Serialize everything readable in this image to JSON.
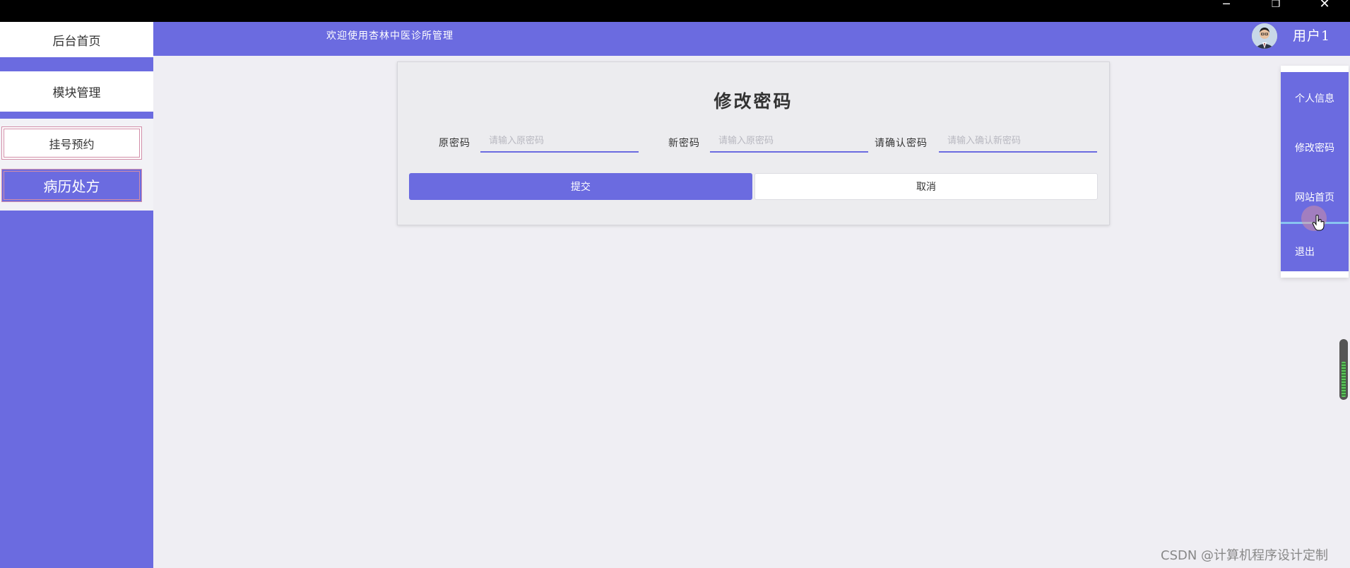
{
  "window": {
    "minimize_glyph": "─",
    "restore_glyph": "❐",
    "close_glyph": "✕"
  },
  "sidebar": {
    "home_label": "后台首页",
    "module_label": "模块管理",
    "items": [
      {
        "label": "挂号预约"
      },
      {
        "label": "病历处方"
      }
    ]
  },
  "header": {
    "welcome_text": "欢迎使用杏林中医诊所管理",
    "username": "用户1"
  },
  "form": {
    "title": "修改密码",
    "fields": [
      {
        "label": "原密码",
        "placeholder": "请输入原密码"
      },
      {
        "label": "新密码",
        "placeholder": "请输入原密码"
      },
      {
        "label": "请确认密码",
        "placeholder": "请输入确认新密码"
      }
    ],
    "submit_label": "提交",
    "cancel_label": "取消"
  },
  "user_menu": {
    "items": [
      {
        "label": "个人信息"
      },
      {
        "label": "修改密码"
      },
      {
        "label": "网站首页"
      },
      {
        "label": "退出"
      }
    ]
  },
  "watermark": "CSDN @计算机程序设计定制",
  "colors": {
    "accent": "#6b6be0",
    "background": "#efeef3",
    "sidebar_item_border": "#d28da8"
  }
}
